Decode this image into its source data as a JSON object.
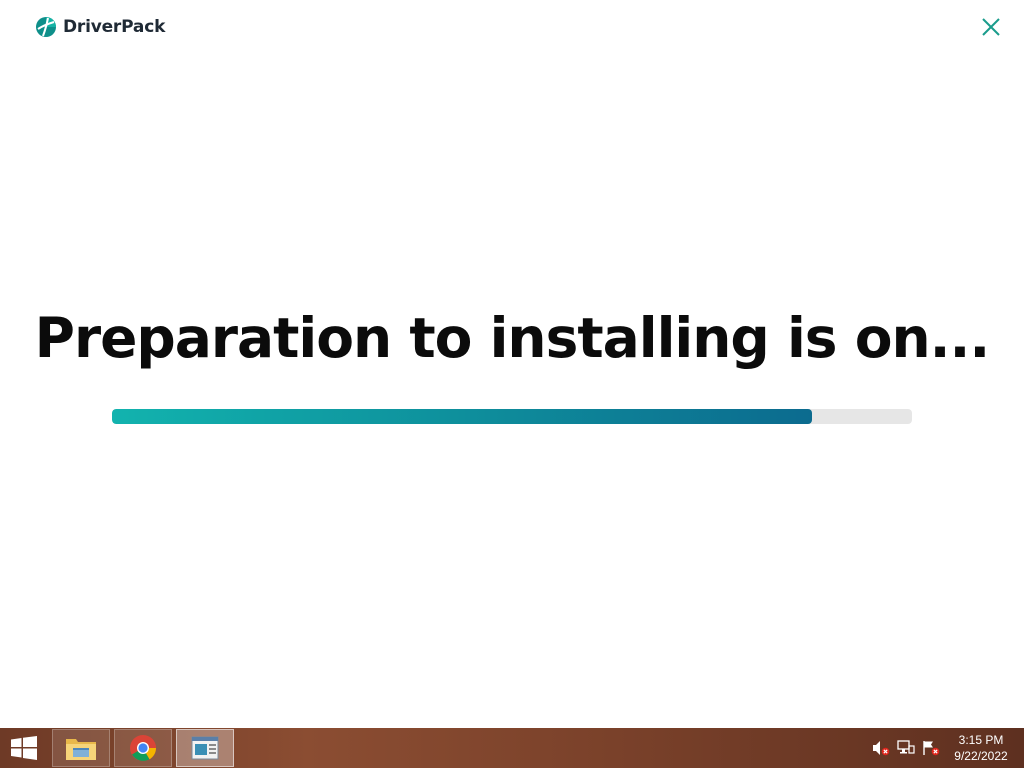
{
  "app": {
    "name": "DriverPack",
    "headline": "Preparation to installing is on...",
    "progress_fraction": 0.875,
    "colors": {
      "accent": "#12b3ae",
      "accent_dark": "#0c6b8f",
      "track": "#e6e6e6",
      "text": "#0b0b0b",
      "close": "#1a9c8c"
    }
  },
  "taskbar": {
    "apps": [
      {
        "name": "file-explorer",
        "icon": "folder-icon"
      },
      {
        "name": "google-chrome",
        "icon": "chrome-icon"
      },
      {
        "name": "driverpack-window",
        "icon": "window-icon"
      }
    ],
    "tray": [
      {
        "icon": "volume-muted-icon"
      },
      {
        "icon": "network-icon"
      },
      {
        "icon": "action-center-flag-icon"
      }
    ],
    "clock": {
      "time": "3:15 PM",
      "date": "9/22/2022"
    }
  }
}
